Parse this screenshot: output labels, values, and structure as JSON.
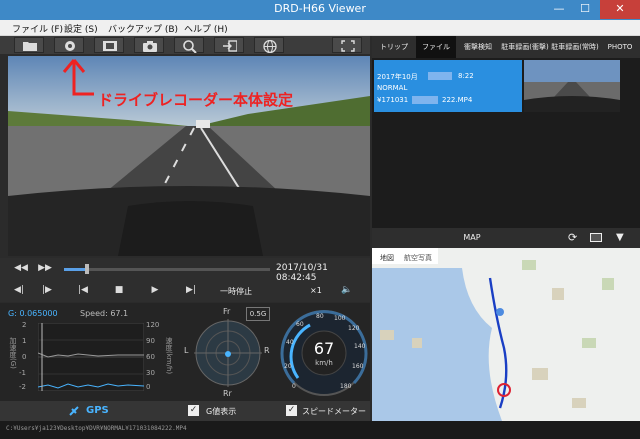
{
  "window": {
    "title": "DRD-H66 Viewer",
    "minimize": "—",
    "maximize": "☐",
    "close": "✕"
  },
  "menu": [
    {
      "label": "ファイル (F)"
    },
    {
      "label": "設定 (S)"
    },
    {
      "label": "バックアップ (B)"
    },
    {
      "label": "ヘルプ (H)"
    }
  ],
  "toolbar": {
    "icons": [
      "folder-icon",
      "gear-icon",
      "film-icon",
      "camera-icon",
      "zoom-icon",
      "export-icon",
      "globe-icon"
    ],
    "fullscreen_icon": "fullscreen-icon"
  },
  "video": {
    "annotation": "ドライブレコーダー本体設定"
  },
  "playback": {
    "timestamp": "2017/10/31  08:42:45",
    "progress": 0.11,
    "pause_label": "一時停止",
    "speed_label": "×1"
  },
  "sensors": {
    "g_value": "G: 0.065000",
    "speed_value": "Speed: 67.1",
    "g_axis_label": "加速度(G)",
    "speed_axis_label": "速度(km/h)",
    "g_ticks": [
      "2",
      "1",
      "0",
      "-1",
      "-2"
    ],
    "speed_ticks": [
      "120",
      "90",
      "60",
      "30",
      "0"
    ],
    "compass": {
      "fr": "Fr",
      "rr": "Rr",
      "l": "L",
      "r": "R"
    },
    "g_range": "0.5G",
    "speedometer": {
      "value": "67",
      "unit": "km/h",
      "ticks": [
        "0",
        "20",
        "40",
        "60",
        "80",
        "100",
        "120",
        "140",
        "160",
        "180"
      ]
    }
  },
  "bottom": {
    "gps_label": "GPS",
    "g_display_label": "G値表示",
    "speedometer_label": "スピードメーター"
  },
  "status": {
    "path": "C:¥Users¥ja123¥Desktop¥DVR¥NORMAL¥171031084222.MP4"
  },
  "tabs": [
    {
      "label": "トリップ"
    },
    {
      "label": "ファイル"
    },
    {
      "label": "衝撃検知"
    },
    {
      "label": "駐車録画(衝撃)"
    },
    {
      "label": "駐車録画(常時)"
    },
    {
      "label": "PHOTO"
    }
  ],
  "file_item": {
    "line1": "2017年10月",
    "line1b": "8:22",
    "line2": "NORMAL",
    "line3": "¥171031",
    "line3b": "222.MP4"
  },
  "map": {
    "title": "MAP",
    "type_map": "地図",
    "type_satellite": "航空写真"
  },
  "colors": {
    "titlebar": "#3e89c7",
    "selected": "#2a8fe0",
    "accent": "#5aa0e8"
  }
}
